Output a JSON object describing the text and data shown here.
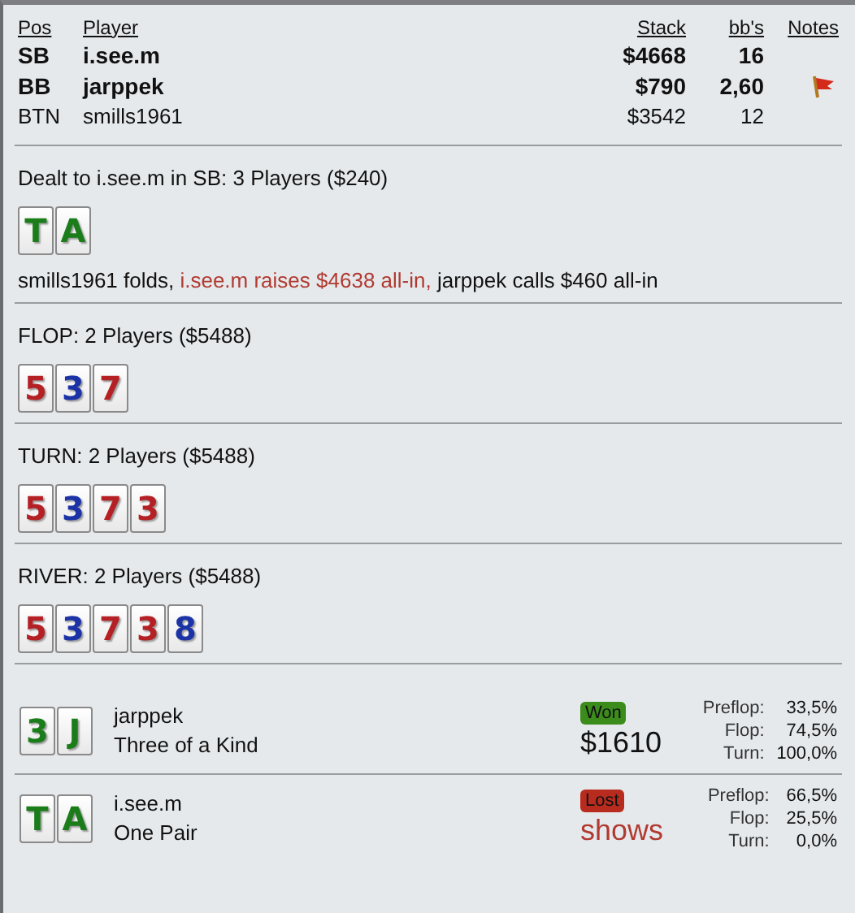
{
  "players": {
    "columns": [
      "Pos",
      "Player",
      "Stack",
      "bb's",
      "Notes"
    ],
    "rows": [
      {
        "pos": "SB",
        "name": "i.see.m",
        "stack": "$4668",
        "bbs": "16",
        "bold": true,
        "note": false
      },
      {
        "pos": "BB",
        "name": "jarppek",
        "stack": "$790",
        "bbs": "2,60",
        "bold": true,
        "note": true
      },
      {
        "pos": "BTN",
        "name": "smills1961",
        "stack": "$3542",
        "bbs": "12",
        "bold": false,
        "note": false
      }
    ]
  },
  "preflop": {
    "title": "Dealt to i.see.m in SB: 3 Players ($240)",
    "cards": [
      {
        "rank": "T",
        "color": "#1a7d1a"
      },
      {
        "rank": "A",
        "color": "#1a7d1a"
      }
    ],
    "actions": [
      {
        "text": "smills1961 folds, ",
        "highlight": false
      },
      {
        "text": "i.see.m raises $4638 all-in, ",
        "highlight": true
      },
      {
        "text": "jarppek calls $460 all-in",
        "highlight": false
      }
    ]
  },
  "streets": [
    {
      "title": "FLOP: 2 Players ($5488)",
      "cards": [
        {
          "rank": "5",
          "color": "#b52025"
        },
        {
          "rank": "3",
          "color": "#1c33a8"
        },
        {
          "rank": "7",
          "color": "#b52025"
        }
      ]
    },
    {
      "title": "TURN: 2 Players ($5488)",
      "cards": [
        {
          "rank": "5",
          "color": "#b52025"
        },
        {
          "rank": "3",
          "color": "#1c33a8"
        },
        {
          "rank": "7",
          "color": "#b52025"
        },
        {
          "rank": "3",
          "color": "#b52025"
        }
      ]
    },
    {
      "title": "RIVER: 2 Players ($5488)",
      "cards": [
        {
          "rank": "5",
          "color": "#b52025"
        },
        {
          "rank": "3",
          "color": "#1c33a8"
        },
        {
          "rank": "7",
          "color": "#b52025"
        },
        {
          "rank": "3",
          "color": "#b52025"
        },
        {
          "rank": "8",
          "color": "#1c33a8"
        }
      ]
    }
  ],
  "results": [
    {
      "cards": [
        {
          "rank": "3",
          "color": "#1a7d1a"
        },
        {
          "rank": "J",
          "color": "#1a7d1a"
        }
      ],
      "name": "jarppek",
      "hand": "Three of a Kind",
      "kind": "won",
      "badge": "Won",
      "amount": "$1610",
      "equity": [
        {
          "label": "Preflop:",
          "value": "33,5%"
        },
        {
          "label": "Flop:",
          "value": "74,5%"
        },
        {
          "label": "Turn:",
          "value": "100,0%"
        }
      ]
    },
    {
      "cards": [
        {
          "rank": "T",
          "color": "#1a7d1a"
        },
        {
          "rank": "A",
          "color": "#1a7d1a"
        }
      ],
      "name": "i.see.m",
      "hand": "One Pair",
      "kind": "lost",
      "badge": "Lost",
      "amount": "shows",
      "equity": [
        {
          "label": "Preflop:",
          "value": "66,5%"
        },
        {
          "label": "Flop:",
          "value": "25,5%"
        },
        {
          "label": "Turn:",
          "value": "0,0%"
        }
      ]
    }
  ]
}
